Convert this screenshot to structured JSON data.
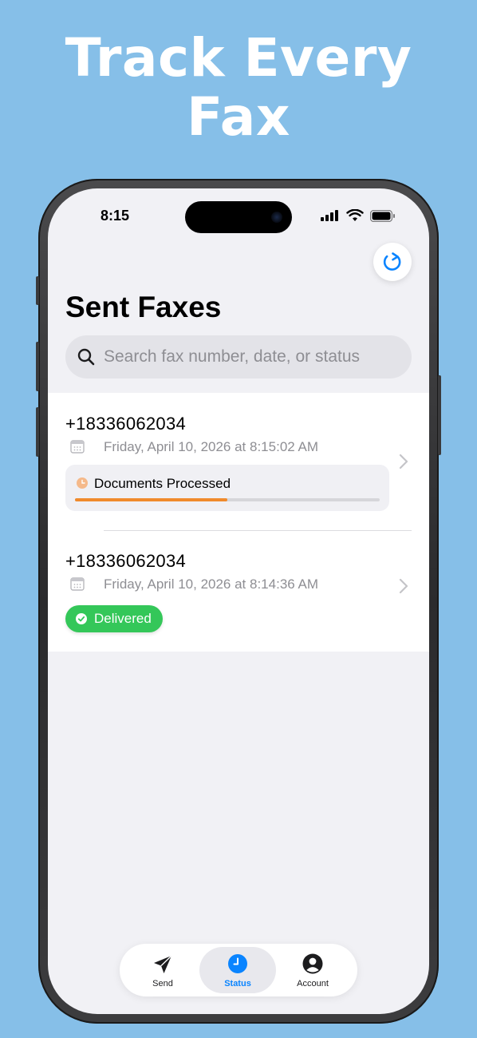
{
  "promo": {
    "headline_line1": "Track Every",
    "headline_line2": "Fax"
  },
  "status_bar": {
    "time": "8:15"
  },
  "page": {
    "title": "Sent Faxes"
  },
  "search": {
    "placeholder": "Search fax number, date, or status"
  },
  "faxes": [
    {
      "number": "+18336062034",
      "date": "Friday, April 10, 2026 at 8:15:02 AM",
      "status": "Documents Processed",
      "progress": 0.5,
      "status_color": "#f08a2c"
    },
    {
      "number": "+18336062034",
      "date": "Friday, April 10, 2026 at 8:14:36 AM",
      "status": "Delivered",
      "status_color": "#34c759"
    }
  ],
  "tabs": [
    {
      "label": "Send",
      "icon": "paper-plane-icon",
      "active": false
    },
    {
      "label": "Status",
      "icon": "clock-icon",
      "active": true
    },
    {
      "label": "Account",
      "icon": "person-circle-icon",
      "active": false
    }
  ],
  "colors": {
    "background": "#86bfe8",
    "accent": "#0a84ff",
    "progress": "#f08a2c",
    "delivered": "#34c759"
  }
}
